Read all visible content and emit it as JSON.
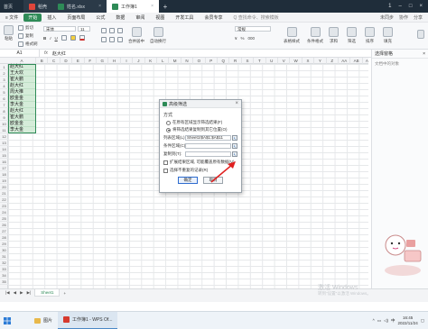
{
  "titlebar": {
    "tabs": [
      {
        "label": "首页",
        "type": "home"
      },
      {
        "label": "稻壳",
        "type": "doc"
      },
      {
        "label": "姓名.xlsx",
        "type": "doc"
      },
      {
        "label": "工作簿1",
        "type": "active"
      }
    ],
    "plus": "+",
    "right_text": "1"
  },
  "menubar": {
    "items": [
      "≡ 文件",
      "开始",
      "插入",
      "页面布局",
      "公式",
      "数据",
      "审阅",
      "视图",
      "开发工具",
      "会员专享"
    ],
    "search": "Q 查找命令、搜索模板",
    "right": [
      "未同步",
      "协作",
      "分享"
    ]
  },
  "ribbon": {
    "paste": "粘贴",
    "cut": "剪切",
    "copy": "复制",
    "format_painter": "格式刷",
    "font_name": "宋体",
    "font_size": "11",
    "merge": "合并居中",
    "wrap": "自动换行",
    "number_format": "常规",
    "table_style": "表格样式",
    "conditional": "条件格式",
    "cell_style": "单元格样式",
    "sum": "求和",
    "filter": "筛选",
    "sort": "排序",
    "fill": "填充"
  },
  "formula": {
    "namebox": "A1",
    "fx": "fx",
    "value": "赵大红"
  },
  "columns": [
    "A",
    "B",
    "C",
    "D",
    "E",
    "F",
    "G",
    "H",
    "I",
    "J",
    "K",
    "L",
    "M",
    "N",
    "O",
    "P",
    "Q",
    "R",
    "S",
    "T",
    "U",
    "V",
    "W",
    "X",
    "Y",
    "Z",
    "AA",
    "AB",
    "AC",
    "AD"
  ],
  "rows": [
    "1",
    "2",
    "3",
    "4",
    "5",
    "6",
    "7",
    "8",
    "9",
    "10",
    "11",
    "12",
    "13",
    "14",
    "15",
    "16",
    "17",
    "18",
    "19",
    "20",
    "21",
    "22",
    "23",
    "24",
    "25",
    "26",
    "27",
    "28",
    "29",
    "30",
    "31",
    "32",
    "33",
    "34",
    "35"
  ],
  "colA": [
    "赵大红",
    "王大欢",
    "崔大鹏",
    "赵大红",
    "周大推",
    "欧金金",
    "李大金",
    "赵大红",
    "崔大鹏",
    "欧金金",
    "李大金"
  ],
  "sidepanel": {
    "title": "选择窗格",
    "subtitle": "文档中的对象"
  },
  "dialog": {
    "title": "高级筛选",
    "close": "×",
    "section": "方式",
    "radio1": "在原有区域显示筛选结果(F)",
    "radio2": "将筛选结果复制到其它位置(O)",
    "list_label": "列表区域(L):",
    "list_value": "Sheet1!$A$1:$A$11",
    "criteria_label": "条件区域(C):",
    "criteria_value": "",
    "copyto_label": "复制到(T):",
    "copyto_value": "",
    "check1": "扩展结果区域, 可能覆盖原有数据(V)",
    "check2": "选择不重复的记录(R)",
    "ok": "确定",
    "cancel": "取消"
  },
  "sheettabs": {
    "sheet": "Sheet1",
    "add": "+"
  },
  "watermark": {
    "line1": "激活 Windows",
    "line2": "转到\"设置\"以激活 Windows。"
  },
  "taskbar": {
    "items": [
      {
        "label": "图片",
        "kind": "folder"
      },
      {
        "label": "工作簿1 - WPS Of...",
        "kind": "wps"
      }
    ],
    "time": "16:45",
    "date": "2022/11/24",
    "lang": "中"
  },
  "colors": {
    "accent": "#2e8b57",
    "titlebar": "#1f2d3a",
    "selection": "#d5ecd9"
  }
}
